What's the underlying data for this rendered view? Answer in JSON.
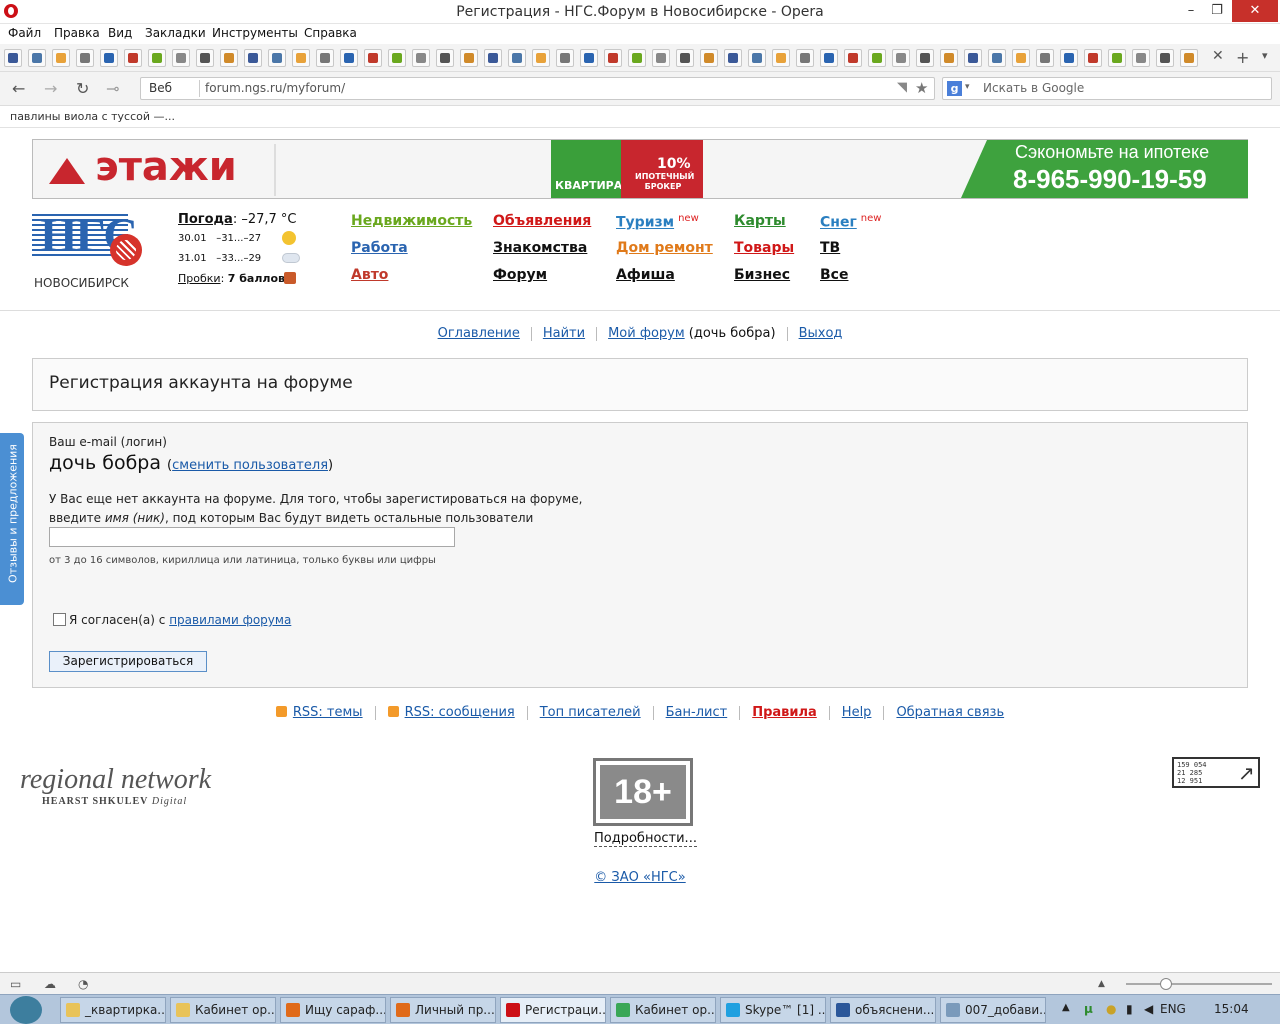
{
  "window": {
    "title": "Регистрация - НГС.Форум в Новосибирске - Opera",
    "controls": {
      "minimize": "–",
      "maximize": "❐",
      "close": "✕"
    }
  },
  "menu": [
    "Файл",
    "Правка",
    "Вид",
    "Закладки",
    "Инструменты",
    "Справка"
  ],
  "bookmarks_icons": [
    "facebook-icon",
    "vk-icon",
    "mail-icon",
    "bookmark-icon",
    "bookmark-icon",
    "bookmark-icon",
    "bookmark-icon",
    "bookmark-icon",
    "bookmark-icon",
    "bookmark-icon",
    "bookmark-icon",
    "bookmark-icon",
    "bookmark-icon",
    "bookmark-icon",
    "bookmark-icon",
    "bookmark-icon",
    "bookmark-icon",
    "bookmark-icon",
    "bookmark-icon",
    "bookmark-icon",
    "bookmark-icon",
    "bookmark-icon",
    "bookmark-icon",
    "bookmark-icon",
    "bookmark-icon",
    "bookmark-icon",
    "bookmark-icon",
    "bookmark-icon",
    "bookmark-icon",
    "bookmark-icon",
    "bookmark-icon",
    "bookmark-icon",
    "bookmark-icon",
    "bookmark-icon",
    "bookmark-icon",
    "bookmark-icon",
    "bookmark-icon",
    "bookmark-icon",
    "bookmark-icon",
    "bookmark-icon",
    "bookmark-icon",
    "bookmark-icon",
    "bookmark-icon",
    "bookmark-icon",
    "bookmark-icon",
    "bookmark-icon",
    "bookmark-icon",
    "bookmark-icon",
    "bookmark-icon",
    "bookmark-icon"
  ],
  "address": {
    "mode_label": "Веб",
    "url": "forum.ngs.ru/myforum/",
    "search_engine": "g",
    "search_placeholder": "Искать в Google"
  },
  "personal_bar": {
    "text": "павлины виола с туссой —..."
  },
  "banner": {
    "brand": "этажи",
    "puzzle_left": "КВАРТИРА",
    "puzzle_pct": "10%",
    "puzzle_sub": "ИПОТЕЧНЫЙ БРОКЕР",
    "slogan": "Сэкономьте на ипотеке",
    "phone": "8-965-990-19-59",
    "colors": {
      "brand_red": "#c8262e",
      "green": "#3ea23e"
    }
  },
  "site": {
    "logo": "НГС",
    "city": "НОВОСИБИРСК",
    "weather": {
      "label": "Погода",
      "temp": ": –27,7 °С",
      "rows": [
        {
          "date": "30.01",
          "range": "–31...–27",
          "icon": "sun-icon"
        },
        {
          "date": "31.01",
          "range": "–33...–29",
          "icon": "cloud-icon"
        }
      ],
      "traffic_label": "Пробки",
      "traffic_value": "7 баллов"
    },
    "nav": [
      {
        "label": "Недвижимость",
        "color": "#6aa81e"
      },
      {
        "label": "Работа",
        "color": "#2a64b0"
      },
      {
        "label": "Авто",
        "color": "#c0392b"
      },
      {
        "label": "Объявления",
        "color": "#d01818"
      },
      {
        "label": "Знакомства",
        "color": "#111111"
      },
      {
        "label": "Форум",
        "color": "#111111"
      },
      {
        "label": "Туризм",
        "color": "#2a7fc0",
        "badge": "new"
      },
      {
        "label": "Дом ремонт",
        "color": "#e07a1a"
      },
      {
        "label": "Афиша",
        "color": "#111111"
      },
      {
        "label": "Карты",
        "color": "#2e8b2e"
      },
      {
        "label": "Товары",
        "color": "#d01818"
      },
      {
        "label": "Бизнес",
        "color": "#111111"
      },
      {
        "label": "Снег",
        "color": "#2a7fc0",
        "badge": "new"
      },
      {
        "label": "ТВ",
        "color": "#111111"
      },
      {
        "label": "Все",
        "color": "#111111"
      }
    ]
  },
  "forum_nav": {
    "contents": "Оглавление",
    "find": "Найти",
    "my_forum": "Мой форум",
    "user": "(дочь бобра)",
    "logout": "Выход"
  },
  "page_title": "Регистрация аккаунта на форуме",
  "form": {
    "email_label": "Ваш e-mail (логин)",
    "username": "дочь бобра",
    "change_user": "сменить пользователя",
    "info_1": "У Вас еще нет аккаунта на форуме. Для того, чтобы зарегистироваться на форуме, введите ",
    "info_em": "имя (ник)",
    "info_2": ", под которым Вас будут видеть остальные пользователи",
    "nick_value": "",
    "hint": "от 3 до 16 символов, кириллица или латиница, только буквы или цифры",
    "agree_text": "Я согласен(а) с ",
    "agree_link": "правилами форума",
    "agree_checked": false,
    "submit": "Зарегистрироваться"
  },
  "side_tab": "Отзывы и предложения",
  "footer": {
    "links": [
      "RSS: темы",
      "RSS: сообщения",
      "Топ писателей",
      "Бан-лист",
      "Правила",
      "Help",
      "Обратная связь"
    ],
    "regional_1": "regional network",
    "regional_2a": "HEARST SHKULEV",
    "regional_2b": "Digital",
    "age": "18+",
    "age_more": "Подробности...",
    "counter": [
      "159 054",
      "21 285",
      "12 951"
    ],
    "copyright": "© ЗАО «НГС»"
  },
  "taskbar": {
    "items": [
      {
        "label": "_квартирка...",
        "icon": "folder-icon",
        "color": "#e8c35a"
      },
      {
        "label": "Кабинет ор...",
        "icon": "folder-icon",
        "color": "#e8c35a"
      },
      {
        "label": "Ищу сараф...",
        "icon": "firefox-icon",
        "color": "#e06a1a"
      },
      {
        "label": "Личный пр...",
        "icon": "firefox-icon",
        "color": "#e06a1a"
      },
      {
        "label": "Регистраци...",
        "icon": "opera-icon",
        "color": "#cc0f16",
        "active": true
      },
      {
        "label": "Кабинет ор...",
        "icon": "chrome-icon",
        "color": "#3aa757"
      },
      {
        "label": "Skype™ [1] ...",
        "icon": "skype-icon",
        "color": "#1fa0e0"
      },
      {
        "label": "объяснени...",
        "icon": "word-icon",
        "color": "#2b579a"
      },
      {
        "label": "007_добави...",
        "icon": "app-icon",
        "color": "#7a9abb"
      }
    ],
    "lang": "ENG",
    "time": "15:04"
  }
}
